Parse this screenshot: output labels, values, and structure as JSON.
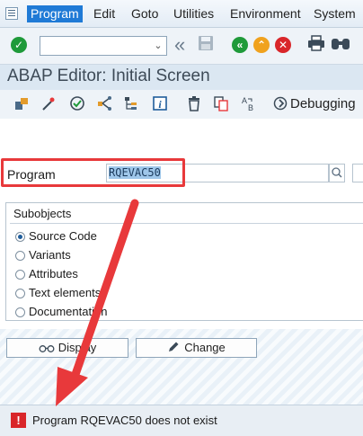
{
  "menu": {
    "items": [
      "Program",
      "Edit",
      "Goto",
      "Utilities",
      "Environment",
      "System"
    ]
  },
  "toolbar": {
    "command_field_value": "",
    "icons": [
      "enter-icon",
      "back-icon",
      "save-icon",
      "green-back-icon",
      "exit-icon",
      "cancel-icon",
      "print-icon",
      "find-icon"
    ]
  },
  "title": "ABAP Editor: Initial Screen",
  "app_toolbar": {
    "icons": [
      "other-object-icon",
      "magic-wand-icon",
      "check-icon",
      "where-used-icon",
      "hierarchy-icon",
      "info-icon",
      "delete-icon",
      "copy-icon",
      "rename-icon",
      "debugging-icon"
    ],
    "debugging_label": "Debugging"
  },
  "program": {
    "label": "Program",
    "value": "RQEVAC50"
  },
  "subobjects": {
    "title": "Subobjects",
    "options": [
      {
        "label": "Source Code",
        "selected": true
      },
      {
        "label": "Variants",
        "selected": false
      },
      {
        "label": "Attributes",
        "selected": false
      },
      {
        "label": "Text elements",
        "selected": false
      },
      {
        "label": "Documentation",
        "selected": false
      }
    ]
  },
  "buttons": {
    "display": "Display",
    "change": "Change"
  },
  "status": {
    "message": "Program RQEVAC50 does not exist",
    "type": "error"
  },
  "colors": {
    "accent": "#1f7ad6",
    "annotation": "#e8393b",
    "error": "#d9262a"
  }
}
